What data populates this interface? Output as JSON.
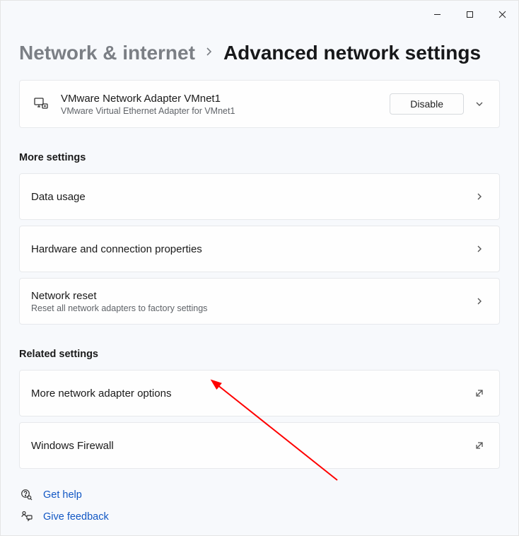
{
  "breadcrumb": {
    "parent": "Network & internet",
    "current": "Advanced network settings"
  },
  "adapter": {
    "title": "VMware Network Adapter VMnet1",
    "subtitle": "VMware Virtual Ethernet Adapter for VMnet1",
    "button": "Disable"
  },
  "sections": {
    "more": "More settings",
    "related": "Related settings"
  },
  "more_rows": {
    "data_usage": "Data usage",
    "hw_props": "Hardware and connection properties",
    "reset_title": "Network reset",
    "reset_sub": "Reset all network adapters to factory settings"
  },
  "related_rows": {
    "adapter_options": "More network adapter options",
    "firewall": "Windows Firewall"
  },
  "footer": {
    "help": "Get help",
    "feedback": "Give feedback"
  }
}
